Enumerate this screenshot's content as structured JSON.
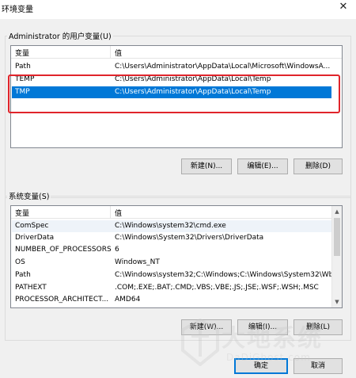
{
  "window": {
    "title": "环境变量",
    "close_glyph": "✕"
  },
  "user_vars": {
    "group_label": "Administrator 的用户变量(U)",
    "col_name": "变量",
    "col_value": "值",
    "rows": [
      {
        "name": "Path",
        "value": "C:\\Users\\Administrator\\AppData\\Local\\Microsoft\\WindowsA..."
      },
      {
        "name": "TEMP",
        "value": "C:\\Users\\Administrator\\AppData\\Local\\Temp"
      },
      {
        "name": "TMP",
        "value": "C:\\Users\\Administrator\\AppData\\Local\\Temp"
      }
    ],
    "new_label": "新建(N)...",
    "edit_label": "编辑(E)...",
    "delete_label": "删除(D)"
  },
  "system_vars": {
    "group_label": "系统变量(S)",
    "col_name": "变量",
    "col_value": "值",
    "rows": [
      {
        "name": "ComSpec",
        "value": "C:\\Windows\\system32\\cmd.exe"
      },
      {
        "name": "DriverData",
        "value": "C:\\Windows\\System32\\Drivers\\DriverData"
      },
      {
        "name": "NUMBER_OF_PROCESSORS",
        "value": "6"
      },
      {
        "name": "OS",
        "value": "Windows_NT"
      },
      {
        "name": "Path",
        "value": "C:\\Windows\\system32;C:\\Windows;C:\\Windows\\System32\\Wb..."
      },
      {
        "name": "PATHEXT",
        "value": ".COM;.EXE;.BAT;.CMD;.VBS;.VBE;.JS;.JSE;.WSF;.WSH;.MSC"
      },
      {
        "name": "PROCESSOR_ARCHITECT...",
        "value": "AMD64"
      }
    ],
    "new_label": "新建(W)...",
    "edit_label": "编辑(I)...",
    "delete_label": "删除(L)"
  },
  "footer": {
    "ok_label": "确定",
    "cancel_label": "取消"
  },
  "watermark": {
    "text": "大地系统",
    "sub": "DaDiGhost.com"
  },
  "colors": {
    "selection": "#0078d7",
    "highlight_box": "#e0242b"
  }
}
